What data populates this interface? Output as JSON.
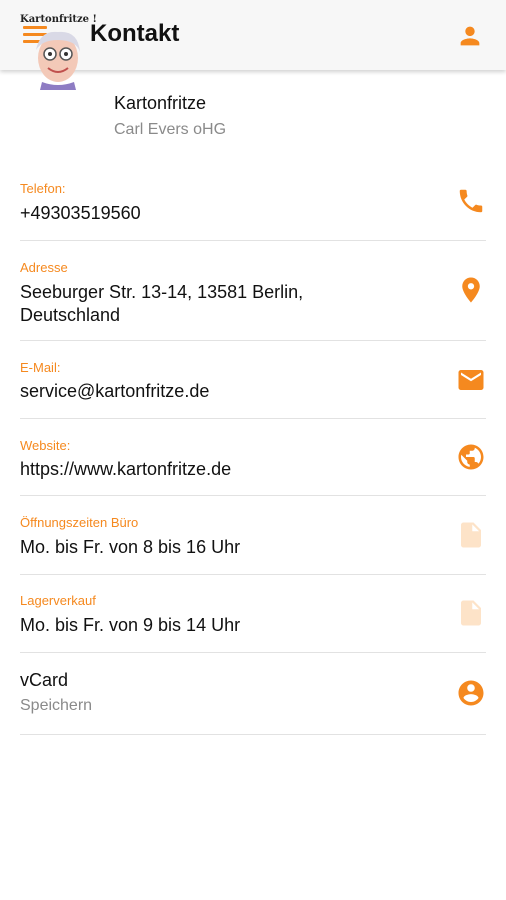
{
  "appbar": {
    "title": "Kontakt",
    "menu_icon": "menu-icon",
    "account_icon": "account-icon"
  },
  "header": {
    "logo_text": "Kartonfritze !",
    "company": "Kartonfritze",
    "owner": "Carl Evers oHG"
  },
  "rows": [
    {
      "label": "Telefon:",
      "value": "+49303519560",
      "icon": "phone-icon"
    },
    {
      "label": "Adresse",
      "value": "Seeburger Str. 13-14, 13581 Berlin, Deutschland",
      "icon": "location-pin-icon"
    },
    {
      "label": "E-Mail:",
      "value": "service@kartonfritze.de",
      "icon": "mail-icon"
    },
    {
      "label": "Website:",
      "value": "https://www.kartonfritze.de",
      "icon": "globe-icon"
    },
    {
      "label": "Öffnungszeiten Büro",
      "value": "Mo. bis Fr. von 8 bis 16 Uhr",
      "icon": "document-icon"
    },
    {
      "label": "Lagerverkauf",
      "value": "Mo. bis Fr. von 9 bis 14 Uhr",
      "icon": "document-icon"
    }
  ],
  "vcard": {
    "title": "vCard",
    "subtitle": "Speichern",
    "icon": "account-circle-icon"
  },
  "colors": {
    "accent": "#f5891f",
    "accent_light": "#fde3c8",
    "divider": "#e2e2e2",
    "muted": "#8a8a8a"
  }
}
